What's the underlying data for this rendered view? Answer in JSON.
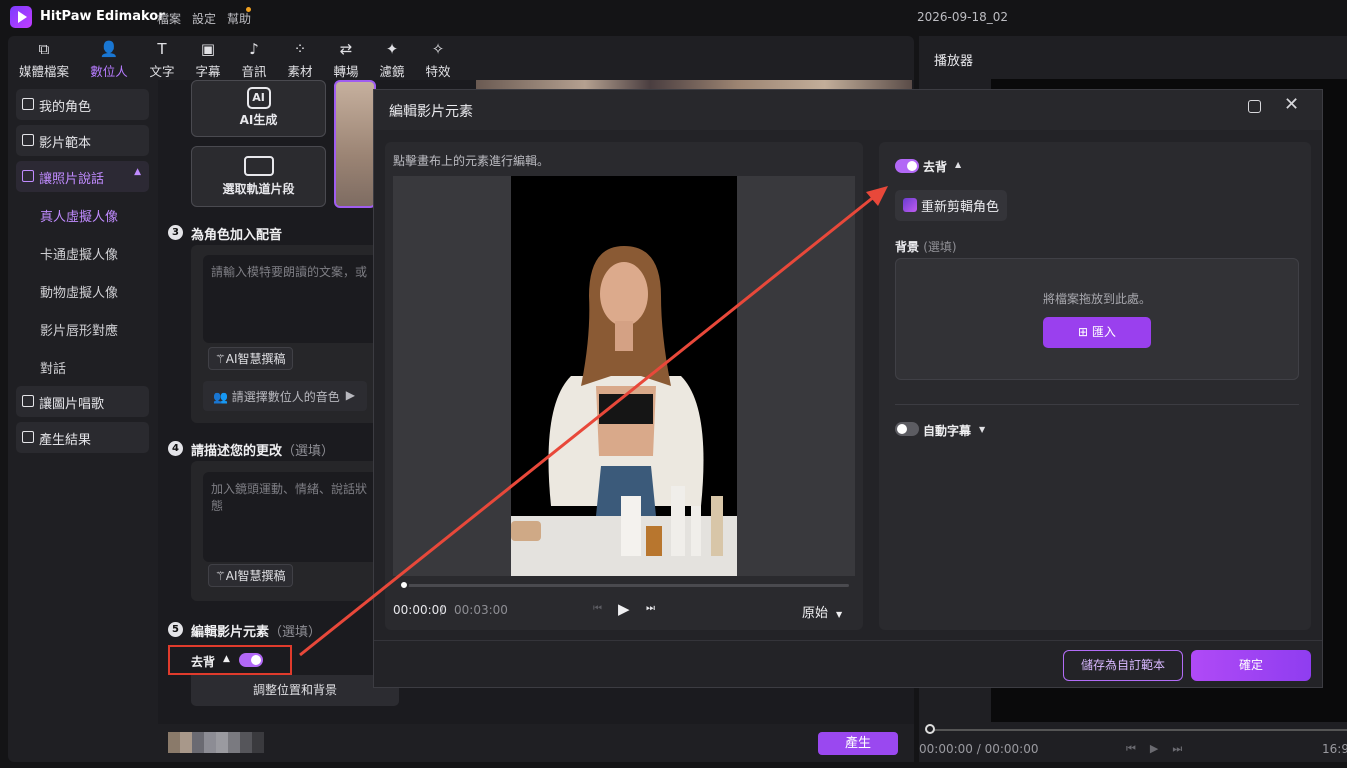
{
  "app": {
    "name": "HitPaw Edimakor",
    "menus": [
      "檔案",
      "設定",
      "幫助"
    ],
    "project_name": "2026-09-18_02"
  },
  "toolbar": {
    "items": [
      {
        "label": "媒體檔案",
        "icon": "media-icon"
      },
      {
        "label": "數位人",
        "icon": "avatar-icon"
      },
      {
        "label": "文字",
        "icon": "text-icon"
      },
      {
        "label": "字幕",
        "icon": "subtitle-icon"
      },
      {
        "label": "音訊",
        "icon": "music-icon"
      },
      {
        "label": "素材",
        "icon": "assets-icon"
      },
      {
        "label": "轉場",
        "icon": "transition-icon"
      },
      {
        "label": "濾鏡",
        "icon": "filter-icon"
      },
      {
        "label": "特效",
        "icon": "effects-icon"
      }
    ],
    "active_index": 1
  },
  "sidebar": {
    "my_role": "我的角色",
    "video_template": "影片範本",
    "photo_talk": "讓照片說話",
    "sub_items": [
      "真人虛擬人像",
      "卡通虛擬人像",
      "動物虛擬人像",
      "影片唇形對應",
      "對話"
    ],
    "image_sing": "讓圖片唱歌",
    "results": "產生結果"
  },
  "content": {
    "ai_generate": "AI生成",
    "select_clip": "選取軌道片段",
    "step3_title": "為角色加入配音",
    "step3_placeholder": "請輸入模特要朗讀的文案，或",
    "ai_writer": "AI智慧撰稿",
    "voice_select": "請選擇數位人的音色",
    "step4_title": "請描述您的更改",
    "optional": "（選填）",
    "step4_placeholder": "加入鏡頭運動、情緒、說話狀態",
    "ai_writer2": "AI智慧撰稿",
    "step5_title": "編輯影片元素",
    "bg_remove": "去背",
    "adjust": "調整位置和背景",
    "generate": "產生"
  },
  "player": {
    "title": "播放器",
    "time": "00:00:00",
    "total": "00:00:00",
    "ratio": "16:9"
  },
  "dialog": {
    "title": "編輯影片元素",
    "hint": "點擊畫布上的元素進行編輯。",
    "current_time": "00:00:00",
    "total_time": "00:03:00",
    "scale": "原始",
    "bg_remove": "去背",
    "recrop": "重新剪輯角色",
    "background_label": "背景",
    "background_optional": "(選填)",
    "drop_hint": "將檔案拖放到此處。",
    "import": "匯入",
    "auto_subtitle": "自動字幕",
    "save_template": "儲存為自訂範本",
    "confirm": "確定"
  },
  "colors": {
    "accent": "#a05df0",
    "highlight": "#e03b2c"
  }
}
